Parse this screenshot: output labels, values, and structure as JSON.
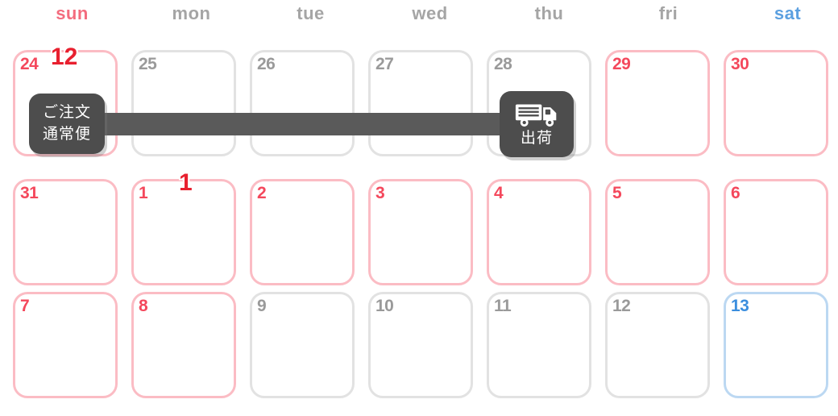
{
  "header": {
    "weekdays": [
      {
        "label": "sun",
        "tone": "red"
      },
      {
        "label": "mon",
        "tone": "normal"
      },
      {
        "label": "tue",
        "tone": "normal"
      },
      {
        "label": "wed",
        "tone": "normal"
      },
      {
        "label": "thu",
        "tone": "normal"
      },
      {
        "label": "fri",
        "tone": "normal"
      },
      {
        "label": "sat",
        "tone": "blue"
      }
    ]
  },
  "month_markers": [
    {
      "label": "12",
      "column": 0,
      "row": 0
    },
    {
      "label": "1",
      "column": 1,
      "row": 1
    }
  ],
  "weeks": [
    {
      "days": [
        {
          "number": "24",
          "tone": "red"
        },
        {
          "number": "25",
          "tone": "gray"
        },
        {
          "number": "26",
          "tone": "gray"
        },
        {
          "number": "27",
          "tone": "gray"
        },
        {
          "number": "28",
          "tone": "gray"
        },
        {
          "number": "29",
          "tone": "red"
        },
        {
          "number": "30",
          "tone": "red"
        }
      ]
    },
    {
      "days": [
        {
          "number": "31",
          "tone": "red"
        },
        {
          "number": "1",
          "tone": "red"
        },
        {
          "number": "2",
          "tone": "red"
        },
        {
          "number": "3",
          "tone": "red"
        },
        {
          "number": "4",
          "tone": "red"
        },
        {
          "number": "5",
          "tone": "red"
        },
        {
          "number": "6",
          "tone": "red"
        }
      ]
    },
    {
      "days": [
        {
          "number": "7",
          "tone": "red"
        },
        {
          "number": "8",
          "tone": "red"
        },
        {
          "number": "9",
          "tone": "gray"
        },
        {
          "number": "10",
          "tone": "gray"
        },
        {
          "number": "11",
          "tone": "gray"
        },
        {
          "number": "12",
          "tone": "gray"
        },
        {
          "number": "13",
          "tone": "blue"
        }
      ]
    }
  ],
  "overlay": {
    "order_badge": {
      "line1": "ご注文",
      "line2": "通常便",
      "day": "24"
    },
    "shipping_badge": {
      "label": "出荷",
      "icon": "truck-icon",
      "day": "28"
    },
    "flow_bar": {
      "from_day": "24",
      "to_day": "28"
    }
  },
  "colors": {
    "holiday": "#fbbcc4",
    "saturday": "#bcd8f2",
    "weekday": "#e2e2e2",
    "holiday_text": "#f4485c",
    "saturday_text": "#3b8ede",
    "weekday_text": "#9a9a9a",
    "badge_bg": "#4d4d4d",
    "flow_bar": "#5a5a5a",
    "month_marker": "#e8202f"
  }
}
